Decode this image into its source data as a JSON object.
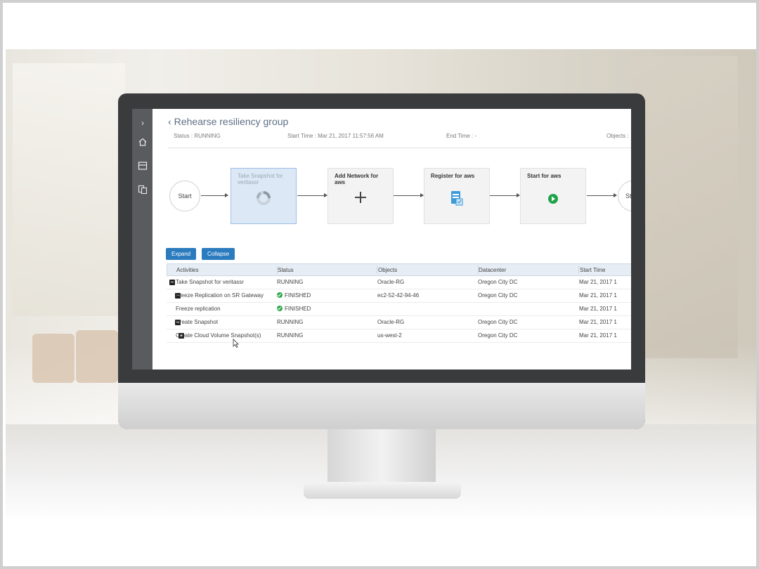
{
  "app": {
    "title": "Rehearse resiliency group",
    "meta": {
      "status": "Status :  RUNNING",
      "start_time": "Start Time : Mar 21, 2017 11:57:56 AM",
      "end_time": "End Time : -",
      "objects": "Objects :"
    }
  },
  "nav": {
    "icons": [
      "chevron-right-icon",
      "home-icon",
      "layout-icon",
      "copy-icon"
    ]
  },
  "workflow": {
    "start_label": "Start",
    "end_label": "St",
    "steps": [
      {
        "label": "Take Snapshot for veritassr",
        "icon": "spinner-icon",
        "state": "active"
      },
      {
        "label": "Add Network for aws",
        "icon": "plus-icon",
        "state": "pending"
      },
      {
        "label": "Register for aws",
        "icon": "register-icon",
        "state": "pending"
      },
      {
        "label": "Start for aws",
        "icon": "play-icon",
        "state": "pending"
      }
    ]
  },
  "buttons": {
    "expand": "Expand",
    "collapse": "Collapse"
  },
  "table": {
    "columns": [
      "Activities",
      "Status",
      "Objects",
      "Datacenter",
      "Start Time"
    ],
    "rows": [
      {
        "toggle": "minus",
        "indent": 0,
        "activity": "Take Snapshot for veritassr",
        "status": "RUNNING",
        "finished": false,
        "object": "Oracle-RG",
        "datacenter": "Oregon City DC",
        "start": "Mar 21, 2017 1"
      },
      {
        "toggle": "minus",
        "indent": 1,
        "activity": "Freeze Replication on SR Gateway",
        "status": "FINISHED",
        "finished": true,
        "object": "ec2-52-42-94-46",
        "datacenter": "Oregon City DC",
        "start": "Mar 21, 2017 1"
      },
      {
        "toggle": "",
        "indent": 2,
        "activity": "Freeze replication",
        "status": "FINISHED",
        "finished": true,
        "object": "",
        "datacenter": "",
        "start": "Mar 21, 2017 1"
      },
      {
        "toggle": "minus",
        "indent": 1,
        "activity": "Create Snapshot",
        "status": "RUNNING",
        "finished": false,
        "object": "Oracle-RG",
        "datacenter": "Oregon City DC",
        "start": "Mar 21, 2017 1"
      },
      {
        "toggle": "plus",
        "indent": 2,
        "activity": "Create Cloud Volume Snapshot(s)",
        "status": "RUNNING",
        "finished": false,
        "object": "us-west-2",
        "datacenter": "Oregon City DC",
        "start": "Mar 21, 2017 1"
      }
    ]
  },
  "colors": {
    "accent": "#2b7bbf",
    "title": "#5d6f85",
    "success": "#2ea84a",
    "nav_bg": "#5a5b5e"
  }
}
